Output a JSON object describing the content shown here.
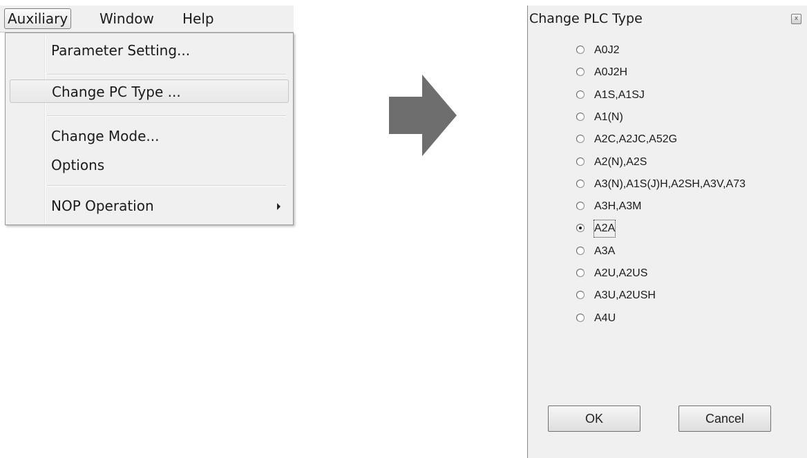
{
  "menubar": {
    "items": [
      "Auxiliary",
      "Window",
      "Help"
    ]
  },
  "dropdown": {
    "items": [
      {
        "label": "Parameter Setting..."
      },
      {
        "label": "Change PC Type ..."
      },
      {
        "label": "Change Mode..."
      },
      {
        "label": "Options"
      },
      {
        "label": "NOP Operation"
      }
    ]
  },
  "dialog": {
    "title": "Change PLC Type",
    "close_label": "x",
    "options": [
      "A0J2",
      "A0J2H",
      "A1S,A1SJ",
      "A1(N)",
      "A2C,A2JC,A52G",
      "A2(N),A2S",
      "A3(N),A1S(J)H,A2SH,A3V,A73",
      "A3H,A3M",
      "A2A",
      "A3A",
      "A2U,A2US",
      "A3U,A2USH",
      "A4U"
    ],
    "selected": "A2A",
    "ok_label": "OK",
    "cancel_label": "Cancel"
  },
  "colors": {
    "arrow": "#6e6e6e",
    "menu_background": "#f0f0f0"
  },
  "icons": {
    "arrow": "right-arrow-icon",
    "submenu": "chevron-right-icon",
    "close": "close-icon"
  }
}
